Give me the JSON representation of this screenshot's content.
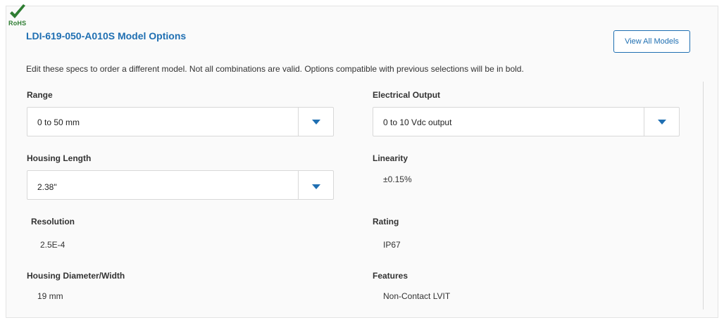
{
  "badge": {
    "text": "RoHS",
    "icon": "checkmark-icon",
    "color": "#2e7d32"
  },
  "title": "LDI-619-050-A010S Model Options",
  "view_all_label": "View All Models",
  "instructions": "Edit these specs to order a different model. Not all combinations are valid. Options compatible with previous selections will be in bold.",
  "specs": {
    "range": {
      "label": "Range",
      "value": "0 to 50 mm"
    },
    "housing_length": {
      "label": "Housing Length",
      "value": "2.38\""
    },
    "resolution": {
      "label": "Resolution",
      "value": "2.5E-4"
    },
    "housing_diameter": {
      "label": "Housing  Diameter/Width",
      "value": "19 mm"
    },
    "electrical_output": {
      "label": "Electrical  Output",
      "value": "0 to 10 Vdc output"
    },
    "linearity": {
      "label": "Linearity",
      "value": "±0.15%"
    },
    "rating": {
      "label": "Rating",
      "value": "IP67"
    },
    "features": {
      "label": "Features",
      "value": "Non-Contact  LVIT"
    }
  },
  "colors": {
    "accent": "#1f6fb2",
    "border": "#d8d8d8",
    "panel_bg": "#fafafa"
  }
}
